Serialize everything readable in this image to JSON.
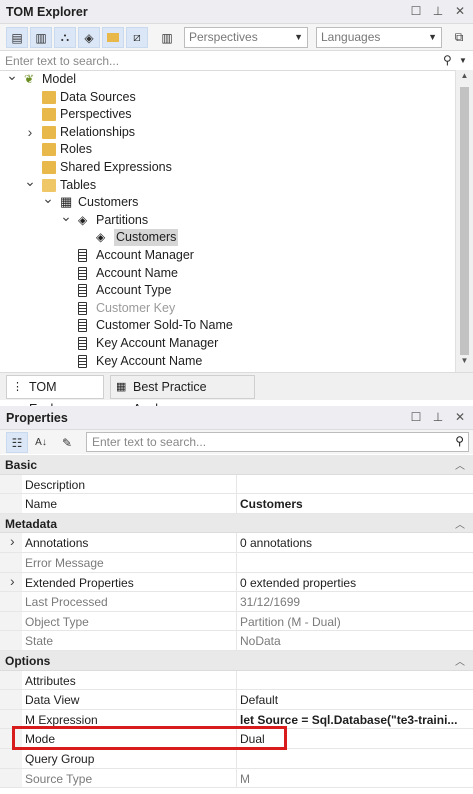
{
  "tom_explorer": {
    "title": "TOM Explorer",
    "perspectives_placeholder": "Perspectives",
    "languages_placeholder": "Languages",
    "search_placeholder": "Enter text to search...",
    "tree": [
      {
        "label": "Model",
        "twist": "v",
        "icon": "model-icon",
        "muted": false
      },
      {
        "label": "Data Sources",
        "twist": "",
        "icon": "folder-icon",
        "muted": false
      },
      {
        "label": "Perspectives",
        "twist": "",
        "icon": "folder-icon",
        "muted": false
      },
      {
        "label": "Relationships",
        "twist": ">",
        "icon": "folder-icon",
        "muted": false
      },
      {
        "label": "Roles",
        "twist": "",
        "icon": "folder-icon",
        "muted": false
      },
      {
        "label": "Shared Expressions",
        "twist": "",
        "icon": "folder-icon",
        "muted": false
      },
      {
        "label": "Tables",
        "twist": "v",
        "icon": "folder-open-icon",
        "muted": false
      },
      {
        "label": "Customers",
        "twist": "v",
        "icon": "table-icon",
        "muted": false
      },
      {
        "label": "Partitions",
        "twist": "v",
        "icon": "partition-icon",
        "muted": false
      },
      {
        "label": "Customers",
        "twist": "",
        "icon": "partition-icon",
        "muted": false,
        "selected": true
      },
      {
        "label": "Account Manager",
        "twist": "",
        "icon": "column-icon",
        "muted": false
      },
      {
        "label": "Account Name",
        "twist": "",
        "icon": "column-icon",
        "muted": false
      },
      {
        "label": "Account Type",
        "twist": "",
        "icon": "column-icon",
        "muted": false
      },
      {
        "label": "Customer Key",
        "twist": "",
        "icon": "column-icon",
        "muted": true
      },
      {
        "label": "Customer Sold-To Name",
        "twist": "",
        "icon": "column-icon",
        "muted": false
      },
      {
        "label": "Key Account Manager",
        "twist": "",
        "icon": "column-icon",
        "muted": false
      },
      {
        "label": "Key Account Name",
        "twist": "",
        "icon": "column-icon",
        "muted": false
      }
    ],
    "tabs": [
      "TOM Explorer",
      "Best Practice Analyzer"
    ]
  },
  "properties": {
    "title": "Properties",
    "search_placeholder": "Enter text to search...",
    "rows": [
      {
        "type": "cat",
        "k": "Basic"
      },
      {
        "type": "row",
        "k": "Description",
        "v": "",
        "muted": false
      },
      {
        "type": "row",
        "k": "Name",
        "v": "Customers",
        "bold": true,
        "muted": false
      },
      {
        "type": "cat",
        "k": "Metadata"
      },
      {
        "type": "row",
        "k": "Annotations",
        "v": "0 annotations",
        "expand": true,
        "muted": false
      },
      {
        "type": "row",
        "k": "Error Message",
        "v": "",
        "muted": true
      },
      {
        "type": "row",
        "k": "Extended Properties",
        "v": "0 extended properties",
        "expand": true,
        "muted": false
      },
      {
        "type": "row",
        "k": "Last Processed",
        "v": "31/12/1699",
        "muted": true
      },
      {
        "type": "row",
        "k": "Object Type",
        "v": "Partition (M - Dual)",
        "muted": true
      },
      {
        "type": "row",
        "k": "State",
        "v": "NoData",
        "muted": true
      },
      {
        "type": "cat",
        "k": "Options"
      },
      {
        "type": "row",
        "k": "Attributes",
        "v": "",
        "muted": false
      },
      {
        "type": "row",
        "k": "Data View",
        "v": "Default",
        "muted": false
      },
      {
        "type": "row",
        "k": "M Expression",
        "v": "let    Source = Sql.Database(\"te3-traini...",
        "bold": true,
        "muted": false
      },
      {
        "type": "row",
        "k": "Mode",
        "v": "Dual",
        "muted": false
      },
      {
        "type": "row",
        "k": "Query Group",
        "v": "",
        "muted": false
      },
      {
        "type": "row",
        "k": "Source Type",
        "v": "M",
        "muted": true
      }
    ]
  },
  "colors": {
    "highlight": "#d81c1c",
    "selection": "#d6d6d6"
  }
}
